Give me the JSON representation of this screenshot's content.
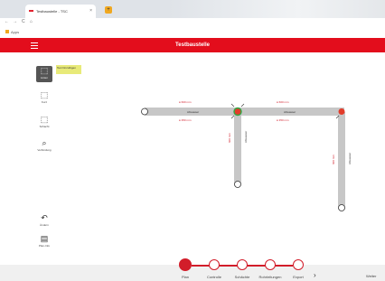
{
  "browser": {
    "tab_title": "Testbaustelle - TSC",
    "tab_close": "×",
    "new_tab": "+",
    "nav_back": "←",
    "nav_forward": "→",
    "nav_reload": "C",
    "nav_home": "⌂",
    "bookmark_label": "Apps"
  },
  "app": {
    "title": "Testbaustelle",
    "accent_color": "#e30d1c",
    "note_text": "Text hinzufügen"
  },
  "tools": [
    {
      "label": "Linien",
      "icon": "⬚"
    },
    {
      "label": "Kurz",
      "icon": "⬚"
    },
    {
      "label": "Schacht",
      "icon": "⬚"
    },
    {
      "label": "Verbindung",
      "icon": "⌕"
    },
    {
      "label": "Ändern",
      "icon": "↶"
    },
    {
      "label": "Plan-Info",
      "icon": "▤"
    }
  ],
  "canvas_labels": {
    "top_left_a": "● 600 mm",
    "top_left_b": "● 350 mm",
    "top_right_a": "● 600 mm",
    "top_right_b": "● 350 mm",
    "pipe1_label": "Abwasser",
    "pipe2_label": "Abwasser",
    "vert1_a": "600 mm",
    "vert1_b": "Abwasser",
    "vert2_a": "600 mm",
    "vert2_b": "Abwasser"
  },
  "steps": [
    "Plan",
    "Controlle",
    "Schächte",
    "Rohrleitungen",
    "Export"
  ],
  "next_chevron": "›",
  "right_label": "Weiter"
}
